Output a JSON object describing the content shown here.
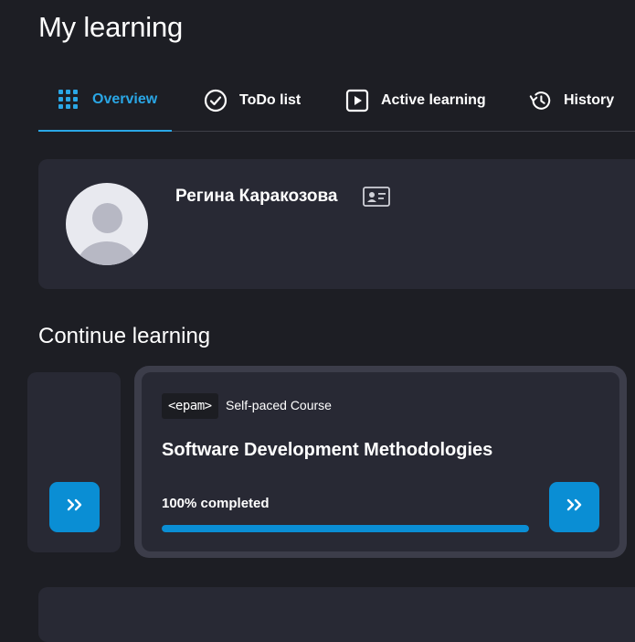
{
  "page": {
    "title": "My learning"
  },
  "tabs": [
    {
      "label": "Overview",
      "icon": "grid-icon",
      "active": true
    },
    {
      "label": "ToDo list",
      "icon": "check-circle-icon",
      "active": false
    },
    {
      "label": "Active learning",
      "icon": "play-icon",
      "active": false
    },
    {
      "label": "History",
      "icon": "history-icon",
      "active": false
    }
  ],
  "profile": {
    "name": "Регина Каракозова",
    "icon": "id-card-icon"
  },
  "continue": {
    "title": "Continue learning",
    "course": {
      "provider": "<epam>",
      "type": "Self-paced Course",
      "title": "Software Development Methodologies",
      "progress_label": "100% completed",
      "progress": 1.0
    },
    "button_icon": "double-chevron-right-icon"
  },
  "colors": {
    "background": "#1d1e24",
    "card": "#282934",
    "accent": "#0a8ed4",
    "active_tab": "#2aa7e6"
  }
}
